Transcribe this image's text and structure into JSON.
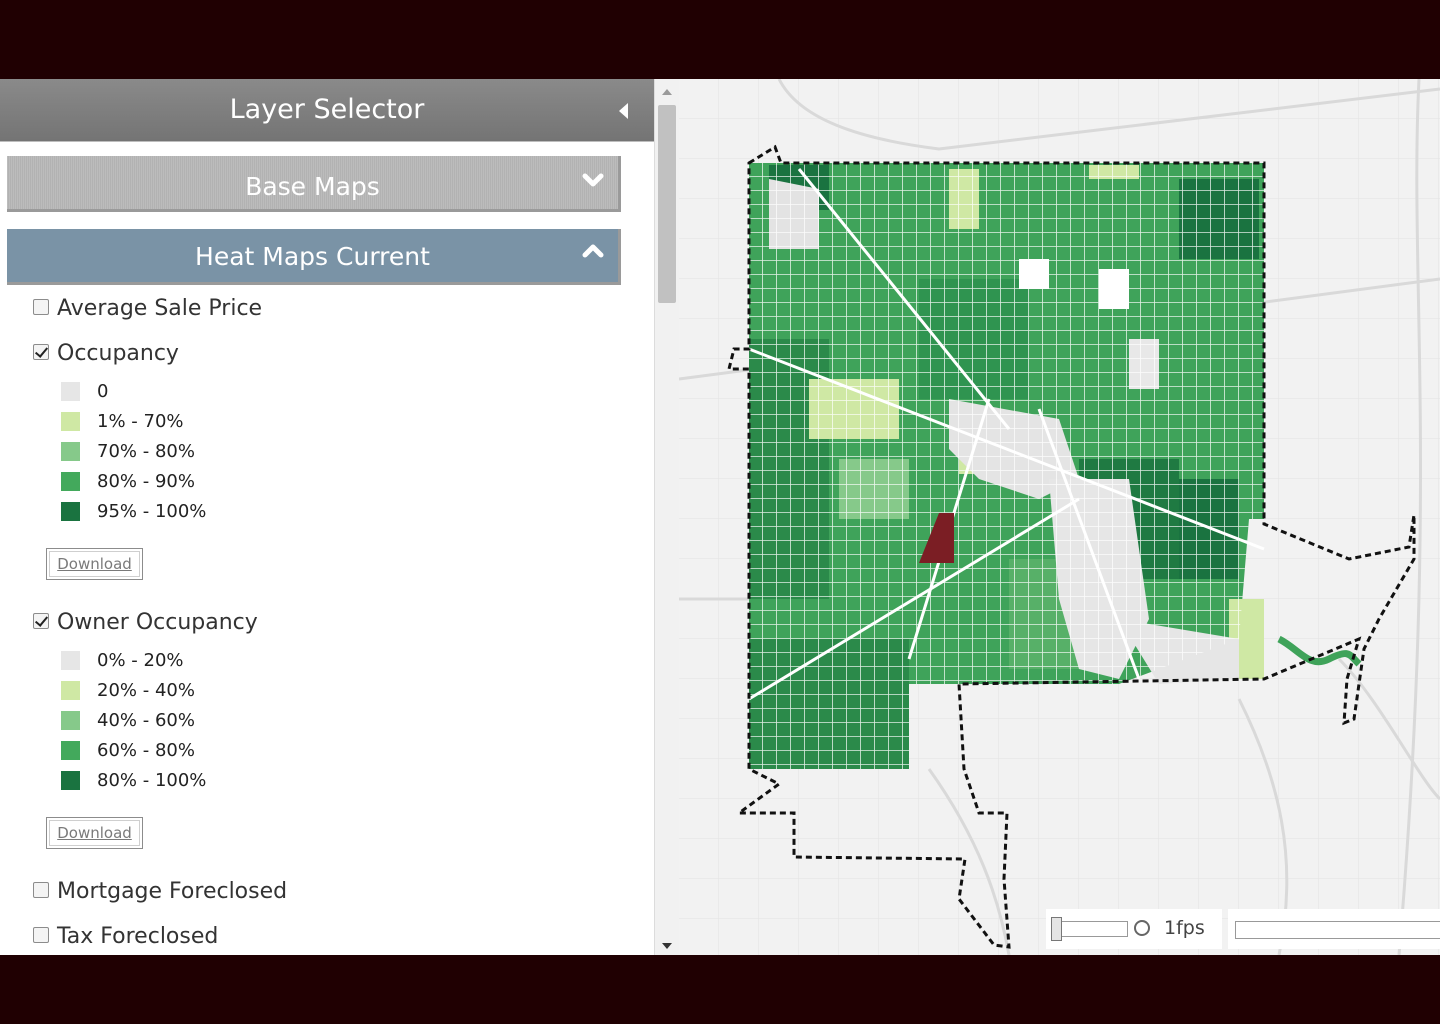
{
  "panel": {
    "title": "Layer Selector",
    "sections": [
      {
        "label": "Base Maps",
        "expanded": false
      },
      {
        "label": "Heat Maps Current",
        "expanded": true
      }
    ]
  },
  "layers": [
    {
      "label": "Average Sale Price",
      "checked": false
    },
    {
      "label": "Occupancy",
      "checked": true,
      "legend": [
        {
          "label": "0",
          "color": "#e6e6e6"
        },
        {
          "label": "1% - 70%",
          "color": "#cfe8a4"
        },
        {
          "label": "70% - 80%",
          "color": "#86c98a"
        },
        {
          "label": "80% - 90%",
          "color": "#43a95c"
        },
        {
          "label": "95% - 100%",
          "color": "#1a7340"
        }
      ],
      "download_label": "Download"
    },
    {
      "label": "Owner Occupancy",
      "checked": true,
      "legend": [
        {
          "label": "0% - 20%",
          "color": "#e6e6e6"
        },
        {
          "label": "20% - 40%",
          "color": "#cfe8a4"
        },
        {
          "label": "40% - 60%",
          "color": "#86c98a"
        },
        {
          "label": "60% - 80%",
          "color": "#43a95c"
        },
        {
          "label": "80% - 100%",
          "color": "#1a7340"
        }
      ],
      "download_label": "Download"
    },
    {
      "label": "Mortgage Foreclosed",
      "checked": false
    },
    {
      "label": "Tax Foreclosed",
      "checked": false
    }
  ],
  "playback": {
    "fps_label": "1fps"
  },
  "colors": {
    "header": "#7f7f7f",
    "accordion_active": "#7a93a6",
    "highlight_parcel": "#7b1e24",
    "boundary": "#111111"
  }
}
